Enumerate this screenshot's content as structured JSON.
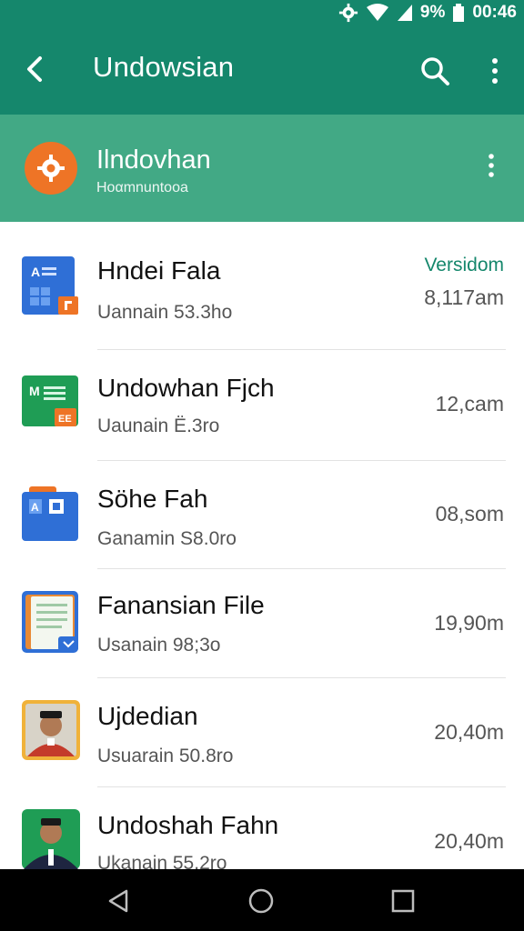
{
  "status_bar": {
    "battery_percent": "9%",
    "time": "00:46",
    "icons": [
      "settings-gear-icon",
      "wifi-icon",
      "signal-icon",
      "battery-icon"
    ]
  },
  "app_bar": {
    "title": "Undowsian",
    "icons": [
      "back-arrow-icon",
      "search-icon",
      "more-vert-icon"
    ]
  },
  "account": {
    "name": "Ilndovhan",
    "subtitle": "Hoαmnuntooa",
    "avatar_color": "#ee7426"
  },
  "files": [
    {
      "title": "Hndei Fala",
      "subtitle": "Uannain 53.3ho",
      "badge": "Versidom",
      "time": "8,117am",
      "icon": "docs-file-icon"
    },
    {
      "title": "Undowhan Fjch",
      "subtitle": "Uaunain Ë.3ro",
      "time": "12,cam",
      "icon": "sheets-file-icon"
    },
    {
      "title": "Söhe Fah",
      "subtitle": "Ganamin S8.0ro",
      "time": "08,som",
      "icon": "folder-file-icon"
    },
    {
      "title": "Fanansian File",
      "subtitle": "Usanain 98;3o",
      "time": "19,90m",
      "icon": "notes-file-icon"
    },
    {
      "title": "Ujdedian",
      "subtitle": "Usuarain 50.8ro",
      "time": "20,40m",
      "icon": "person-photo-icon"
    },
    {
      "title": "Undoshah Fahn",
      "subtitle": "Ukanain 55.2ro",
      "time": "20,40m",
      "icon": "person-photo-icon"
    }
  ],
  "colors": {
    "primary": "#15876c",
    "account_band": "#42a985",
    "accent": "#ee7426"
  },
  "nav_bar": {
    "icons": [
      "back-triangle-icon",
      "home-circle-icon",
      "recents-square-icon"
    ]
  }
}
